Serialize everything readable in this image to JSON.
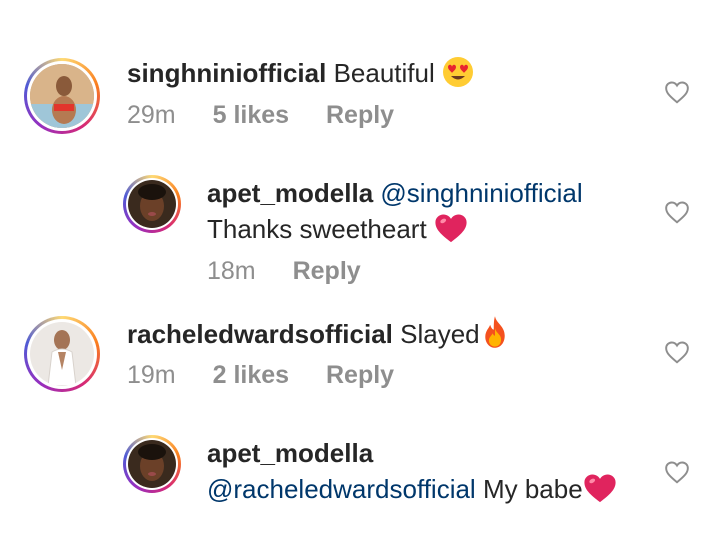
{
  "comments": [
    {
      "username": "singhniniofficial",
      "text": "Beautiful",
      "emoji": "heart-eyes",
      "time": "29m",
      "likes": "5 likes",
      "reply": "Reply"
    },
    {
      "username": "apet_modella",
      "mention": "@singhniniofficial",
      "text": "Thanks sweetheart",
      "emoji": "red-heart",
      "time": "18m",
      "reply": "Reply"
    },
    {
      "username": "racheledwardsofficial",
      "text": "Slayed",
      "emoji": "fire",
      "time": "19m",
      "likes": "2 likes",
      "reply": "Reply"
    },
    {
      "username": "apet_modella",
      "mention": "@racheledwardsofficial",
      "text": "My babe",
      "emoji": "red-heart"
    }
  ],
  "colors": {
    "text": "#262626",
    "muted": "#8e8e8e",
    "mention": "#00376b",
    "heart": "#e0245e"
  }
}
